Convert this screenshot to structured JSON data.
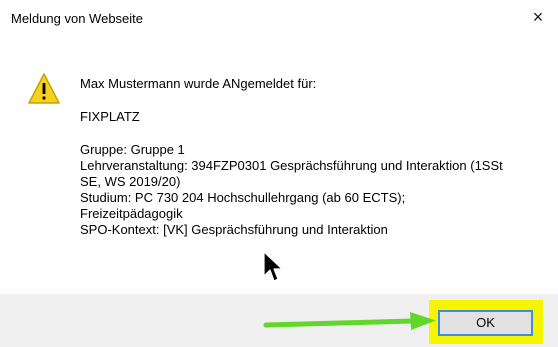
{
  "window": {
    "title": "Meldung von Webseite",
    "close_symbol": "×"
  },
  "message": {
    "line_main": "Max Mustermann wurde ANgemeldet für:",
    "fixplatz": "FIXPLATZ",
    "gruppe": "Gruppe: Gruppe 1",
    "lehrveranstaltung_1": "Lehrveranstaltung: 394FZP0301 Gesprächsführung und Interaktion (1SSt",
    "lehrveranstaltung_2": "SE, WS 2019/20)",
    "studium_1": "Studium: PC 730 204 Hochschullehrgang (ab 60 ECTS);",
    "studium_2": "Freizeitpädagogik",
    "spo": "SPO-Kontext: [VK] Gesprächsführung und Interaktion"
  },
  "buttons": {
    "ok_label": "OK"
  },
  "icons": {
    "warning": "warning-icon",
    "close": "close-icon",
    "annotation_arrow": "green-arrow",
    "cursor": "mouse-cursor-icon"
  },
  "colors": {
    "warning_fill": "#f7d11e",
    "highlight": "#f5f500",
    "arrow": "#63d62a",
    "focus_border": "#3c8fd8",
    "footer_bg": "#f0f0f0"
  }
}
